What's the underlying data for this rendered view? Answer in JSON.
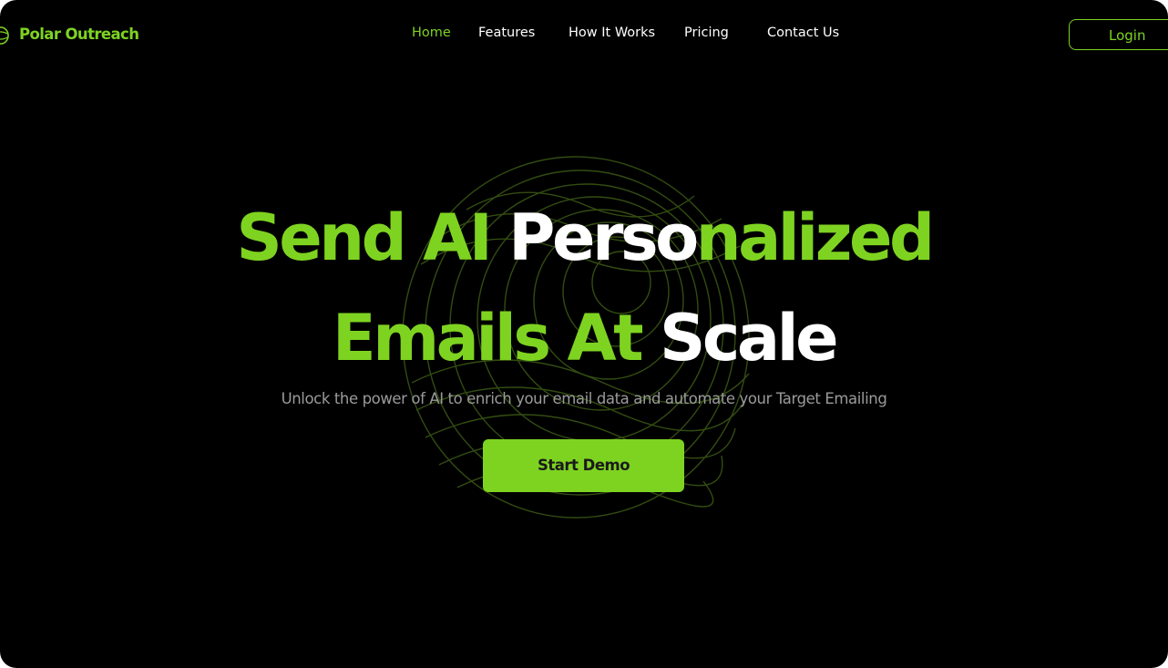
{
  "brand": {
    "name": "Polar Outreach",
    "logo_icon": "polar-globe-icon",
    "accent_color": "#7ed321"
  },
  "nav": {
    "items": [
      {
        "label": "Home",
        "active": true
      },
      {
        "label": "Features",
        "active": false
      },
      {
        "label": "How It Works",
        "active": false
      },
      {
        "label": "Pricing",
        "active": false
      },
      {
        "label": "Contact Us",
        "active": false
      }
    ],
    "login_label": "Login"
  },
  "hero": {
    "line1": {
      "green": "Send AI ",
      "white": "Perso",
      "green2": "nalized"
    },
    "line2": {
      "green": "Emails At ",
      "white": "Scale"
    },
    "subtitle": "Unlock the power of AI to enrich your email  data and automate your Target Emailing",
    "cta_label": "Start Demo",
    "background_graphic": "wireframe-globe-icon"
  }
}
